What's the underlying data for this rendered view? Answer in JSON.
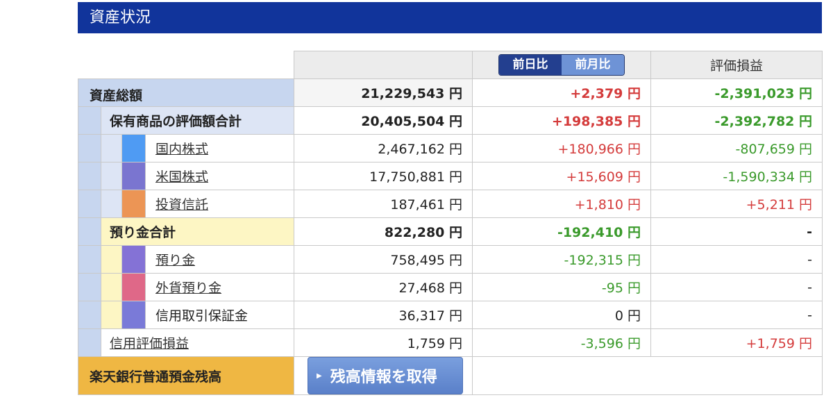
{
  "title": "資産状況",
  "toggle": {
    "daily": "前日比",
    "monthly": "前月比"
  },
  "header": {
    "col4": "評価損益"
  },
  "total": {
    "label": "資産総額",
    "value": "21,229,543 円",
    "change": "+2,379 円",
    "pl": "-2,391,023 円"
  },
  "holdings": {
    "label": "保有商品の評価額合計",
    "value": "20,405,504 円",
    "change": "+198,385 円",
    "pl": "-2,392,782 円",
    "items": [
      {
        "label": "国内株式",
        "value": "2,467,162 円",
        "change": "+180,966 円",
        "pl": "-807,659 円",
        "color": "#4f9bf3"
      },
      {
        "label": "米国株式",
        "value": "17,750,881 円",
        "change": "+15,609 円",
        "pl": "-1,590,334 円",
        "color": "#7a75d0"
      },
      {
        "label": "投資信託",
        "value": "187,461 円",
        "change": "+1,810 円",
        "pl": "+5,211 円",
        "color": "#ec9555"
      }
    ]
  },
  "deposits": {
    "label": "預り金合計",
    "value": "822,280 円",
    "change": "-192,410 円",
    "pl": "-",
    "items": [
      {
        "label": "預り金",
        "value": "758,495 円",
        "change": "-192,315 円",
        "pl": "-",
        "color": "#8472d6"
      },
      {
        "label": "外貨預り金",
        "value": "27,468 円",
        "change": "-95 円",
        "pl": "-",
        "color": "#df6888"
      },
      {
        "label": "信用取引保証金",
        "value": "36,317 円",
        "change": "0 円",
        "pl": "-",
        "color": "#7a7ad8"
      }
    ]
  },
  "margin": {
    "label": "信用評価損益",
    "value": "1,759 円",
    "change": "-3,596 円",
    "pl": "+1,759 円"
  },
  "rakuten": {
    "label": "楽天銀行普通預金残高",
    "button": "残高情報を取得"
  }
}
